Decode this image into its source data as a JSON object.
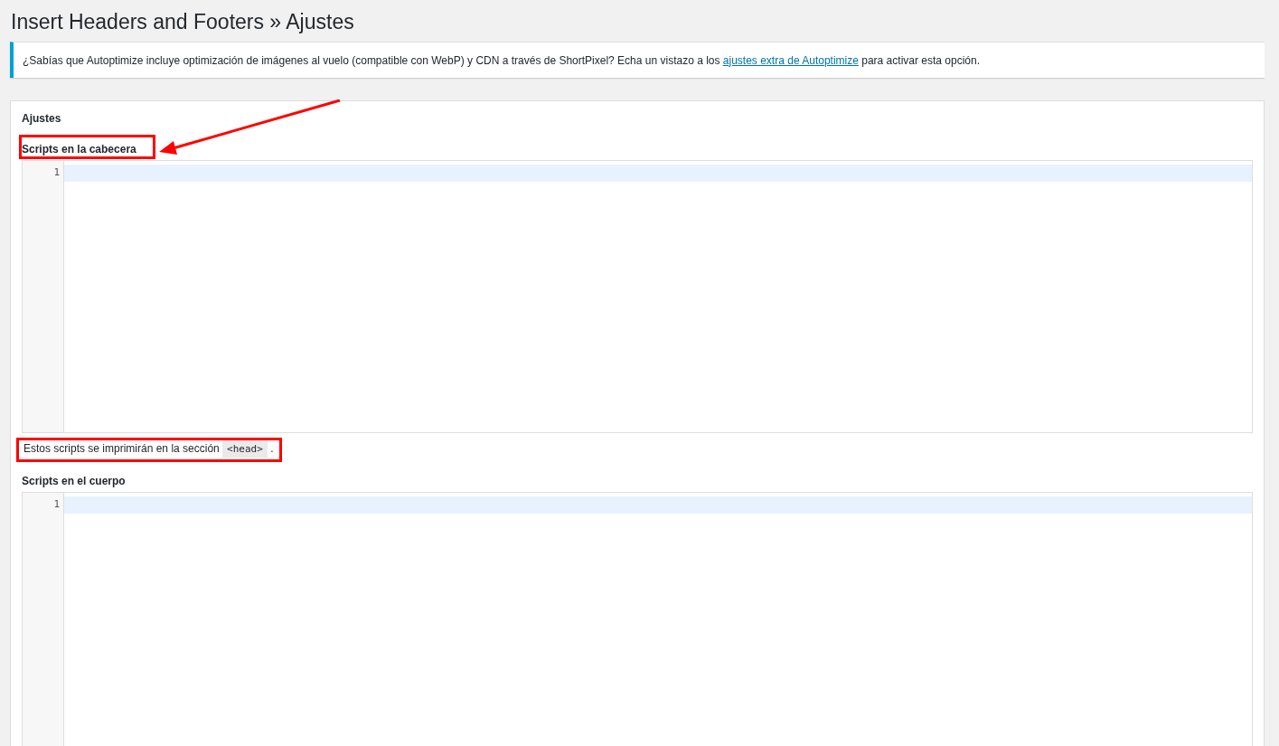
{
  "page_title": "Insert Headers and Footers » Ajustes",
  "notice": {
    "before": "¿Sabías que Autoptimize incluye optimización de imágenes al vuelo (compatible con WebP) y CDN a través de ShortPixel? Echa un vistazo a los ",
    "link": "ajustes extra de Autoptimize",
    "after": " para activar esta opción."
  },
  "panel": {
    "title": "Ajustes",
    "arrow_annotation": true,
    "fields": [
      {
        "label": "Scripts en la cabecera",
        "label_highlighted": true,
        "line_numbers": [
          "1"
        ],
        "help": {
          "text": "Estos scripts se imprimirán en la sección ",
          "code": "<head>",
          "end": ".",
          "highlighted": true
        }
      },
      {
        "label": "Scripts en el cuerpo",
        "label_highlighted": false,
        "line_numbers": [
          "1"
        ]
      }
    ]
  }
}
